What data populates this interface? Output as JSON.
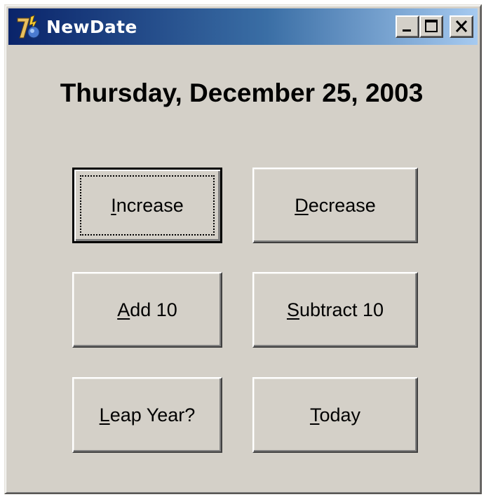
{
  "window": {
    "title": "NewDate",
    "icon": "java-cup-icon"
  },
  "caption_buttons": [
    "minimize",
    "maximize",
    "close"
  ],
  "date_display": "Thursday, December 25, 2003",
  "buttons": [
    {
      "label": "Increase",
      "mnemonic": "I",
      "rest": "ncrease",
      "default": true
    },
    {
      "label": "Decrease",
      "mnemonic": "D",
      "rest": "ecrease"
    },
    {
      "label": "Add 10",
      "mnemonic": "A",
      "rest": "dd 10"
    },
    {
      "label": "Subtract 10",
      "mnemonic": "S",
      "rest": "ubtract 10"
    },
    {
      "label": "Leap Year?",
      "mnemonic": "L",
      "rest": "eap Year?"
    },
    {
      "label": "Today",
      "mnemonic": "T",
      "rest": "oday"
    }
  ]
}
